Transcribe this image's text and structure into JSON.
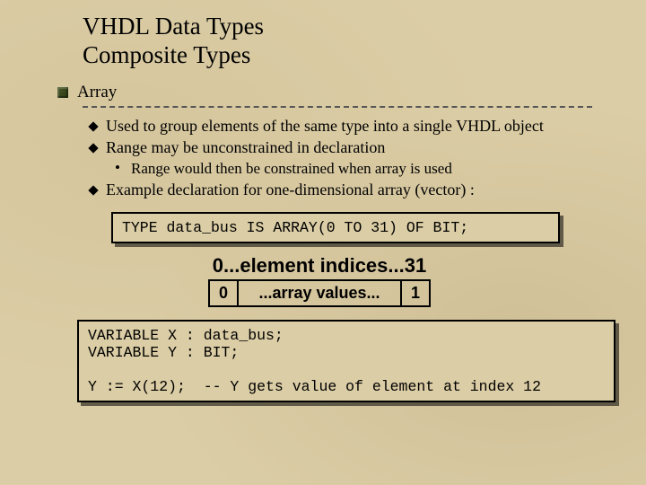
{
  "title_line1": "VHDL Data Types",
  "title_line2": "Composite Types",
  "bullets": {
    "l1": "Array",
    "l2_a": "Used to group elements of the same type into a single VHDL object",
    "l2_b": "Range may be unconstrained in declaration",
    "l3_a": "Range would then be constrained when array is used",
    "l2_c": "Example declaration for one-dimensional array (vector) :"
  },
  "code1": "TYPE data_bus IS ARRAY(0 TO 31) OF BIT;",
  "idx_label": {
    "left": "0",
    "mid": "...element  indices...",
    "right": "31"
  },
  "cells": {
    "left": "0",
    "mid": "...array values...",
    "right": "1"
  },
  "code2": "VARIABLE X : data_bus;\nVARIABLE Y : BIT;\n\nY := X(12);  -- Y gets value of element at index 12"
}
